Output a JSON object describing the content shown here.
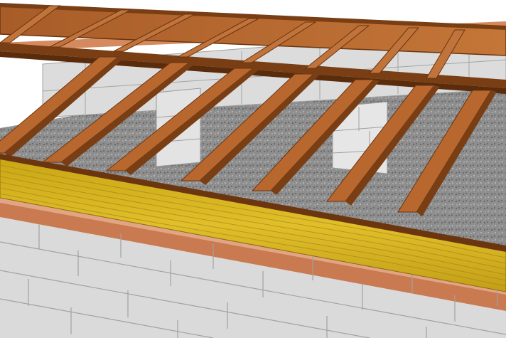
{
  "scene": {
    "subject": "floor framing",
    "colors": {
      "gravel": "#8e8e8e",
      "block": "#d9d9d9",
      "block_line": "#9a9a9a",
      "joist_face": "#b8682f",
      "joist_top": "#7a3e14",
      "rim_board": "#d2ae1a",
      "rim_grain": "#a8871a",
      "sill_plate": "#c97a50",
      "sill_top": "#e2a583"
    }
  }
}
